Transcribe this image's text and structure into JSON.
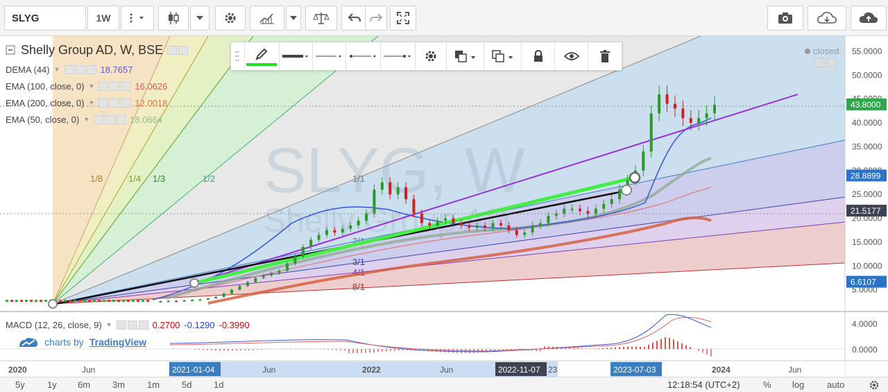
{
  "toolbar": {
    "symbol": "SLYG",
    "interval": "1W"
  },
  "legend": {
    "title": "Shelly Group AD, W, BSE",
    "indicators": [
      {
        "label": "DEMA (44)",
        "value": "18.7657",
        "color": "#6a5acd"
      },
      {
        "label": "EMA (100, close, 0)",
        "value": "16.0626",
        "color": "#e05a5a"
      },
      {
        "label": "EMA (200, close, 0)",
        "value": "12.0018",
        "color": "#d77a4a"
      },
      {
        "label": "EMA (50, close, 0)",
        "value": "18.0664",
        "color": "#8fbc8f"
      }
    ],
    "macd": {
      "label": "MACD (12, 26, close, 9)",
      "v1": "0.2700",
      "v2": "-0.1290",
      "v3": "-0.3990",
      "c1": "#e00000",
      "c2": "#2244cc",
      "c3": "#e00000"
    },
    "closed": "closed"
  },
  "watermark": {
    "main": "SLYG, W",
    "sub": "Shelly Group AD"
  },
  "brand": {
    "prefix": "charts by",
    "name": "TradingView"
  },
  "bottom_bar": {
    "ranges": [
      "5y",
      "1y",
      "6m",
      "3m",
      "1m",
      "5d",
      "1d"
    ],
    "time": "12:18:54",
    "tz": "(UTC+2)",
    "percent": "%",
    "log": "log",
    "auto": "auto"
  },
  "chart_data": {
    "type": "candlestick",
    "title": "Shelly Group AD, W, BSE",
    "x_ticks": [
      "2020",
      "Jun",
      "2021-01-04",
      "Jun",
      "2022",
      "Jun",
      "2022-11-07",
      "23",
      "2023-07-03",
      "2024",
      "Jun"
    ],
    "y_ticks": [
      "55.0000",
      "50.0000",
      "45.0000",
      "40.0000",
      "35.0000",
      "30.0000",
      "25.0000",
      "20.0000",
      "15.0000",
      "10.0000",
      "5.0000"
    ],
    "price_badges": [
      {
        "value": "43.8000",
        "color": "#2ea84c"
      },
      {
        "value": "28.8899",
        "color": "#2a73c9"
      },
      {
        "value": "21.5177",
        "color": "#3d4352"
      },
      {
        "value": "6.6107",
        "color": "#2a73c9"
      }
    ],
    "ylim": [
      0,
      57
    ],
    "price_series": [
      2.5,
      2.6,
      2.7,
      2.6,
      2.8,
      2.9,
      3.0,
      3.2,
      3.5,
      4.2,
      5.0,
      5.8,
      6.6,
      7.5,
      8.0,
      8.5,
      9.0,
      10.5,
      12.0,
      14.0,
      15.5,
      16.5,
      17.5,
      17.0,
      17.8,
      18.5,
      19.5,
      21.0,
      26.0,
      27.5,
      25.0,
      26.5,
      24.0,
      21.0,
      19.0,
      18.5,
      19.5,
      20.0,
      19.0,
      18.5,
      18.0,
      18.5,
      18.0,
      19.0,
      18.5,
      17.5,
      16.5,
      17.0,
      18.5,
      19.0,
      20.5,
      21.0,
      22.0,
      22.0,
      21.5,
      21.0,
      22.0,
      23.0,
      24.0,
      26.0,
      28.0,
      30.0,
      34.0,
      42.0,
      46.0,
      44.0,
      43.0,
      41.0,
      40.0,
      41.0,
      42.0,
      43.8
    ],
    "fan_labels": [
      "1/8",
      "1/4",
      "1/3",
      "1/2",
      "1/1",
      "2/1",
      "3/1",
      "4/1",
      "8/1"
    ],
    "macd_ticks": [
      "4.0000",
      "0.0000"
    ]
  }
}
